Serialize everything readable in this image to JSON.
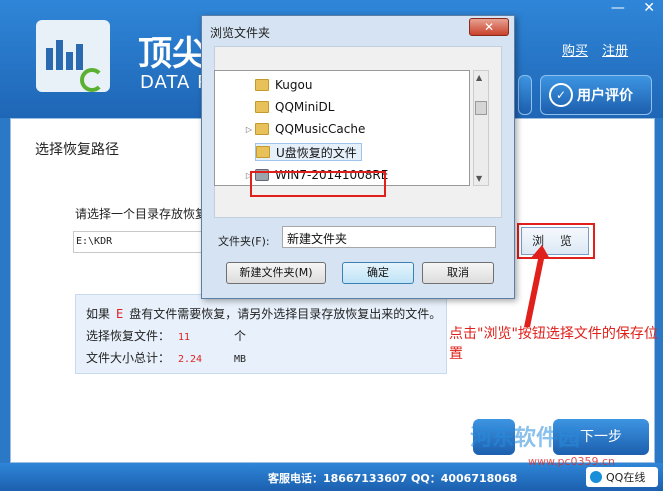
{
  "header": {
    "brand_cn": "顶尖",
    "brand_en": "DATA R",
    "win_min": "—",
    "win_close": "✕",
    "links": [
      "购买",
      "注册"
    ],
    "rate_button": "用户评价"
  },
  "main": {
    "section_title": "选择恢复路径",
    "prompt": "请选择一个目录存放恢复",
    "path_value": "E:\\KDR",
    "browse_label": "浏 览",
    "info": {
      "line1_pre": "如果",
      "drive": "E",
      "line1_post": "盘有文件需要恢复，请另外选择目录存放恢复出来的文件。",
      "files_label": "选择恢复文件：",
      "files_value": "11",
      "files_unit": "个",
      "size_label": "文件大小总计：",
      "size_value": "2.24",
      "size_unit": "MB"
    },
    "annotation": "点击\"浏览\"按钮选择文件的保存位置",
    "next_label": "下一步"
  },
  "dialog": {
    "title": "浏览文件夹",
    "close": "✕",
    "tree": [
      {
        "label": "Kugou",
        "icon": "folder-icon",
        "arrow": ""
      },
      {
        "label": "QQMiniDL",
        "icon": "folder-icon",
        "arrow": ""
      },
      {
        "label": "QQMusicCache",
        "icon": "folder-icon",
        "arrow": "▷"
      },
      {
        "label": "U盘恢复的文件",
        "icon": "folder-icon",
        "arrow": ""
      },
      {
        "label": "WIN7-20141008RE",
        "icon": "network-drive-icon",
        "arrow": "▷"
      }
    ],
    "folder_label": "文件夹(F):",
    "folder_value": "新建文件夹",
    "new_folder_button": "新建文件夹(M)",
    "ok_button": "确定",
    "cancel_button": "取消"
  },
  "footer": {
    "contact": "客服电话：18667133607 QQ：4006718068",
    "qq_button": "QQ在线"
  },
  "watermark": {
    "text": "河东软件园",
    "url": "www.pc0359.cn"
  }
}
